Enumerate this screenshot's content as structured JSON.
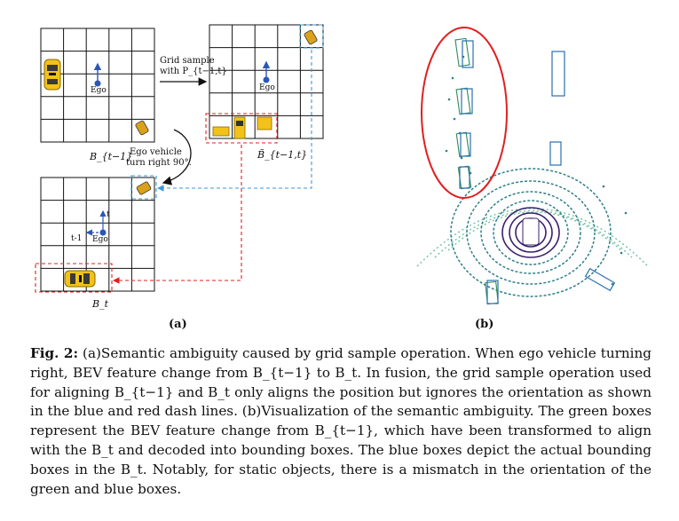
{
  "figure": {
    "panel_a": {
      "grid_top_label": "B_{t−1}",
      "grid_right_label": "B̃_{t−1,t}",
      "grid_bottom_label": "B_t",
      "ego_label": "Ego",
      "arrow_t": "t",
      "arrow_t1": "t-1",
      "grid_sample_line1": "Grid sample",
      "grid_sample_line2": "with P_{t−1,t}",
      "ego_turn_line1": "Ego vehicle",
      "ego_turn_line2": "turn right 90°.",
      "subfig_label": "(a)"
    },
    "panel_b": {
      "subfig_label": "(b)"
    },
    "colors": {
      "grid": "#000000",
      "ego_dot": "#2b56b8",
      "red_dash": "#e02020",
      "blue_dash": "#3a9ad9",
      "ellipse": "#e02020",
      "green_box": "#2e8b57",
      "blue_box": "#2b6fb0",
      "lidar_dark": "#3b1f6b",
      "lidar_mid": "#2f7f8a",
      "lidar_light": "#6fc2a0",
      "taxi_yellow": "#f2c21b"
    }
  },
  "caption": {
    "label": "Fig. 2:",
    "text": "(a)Semantic ambiguity caused by grid sample operation. When ego vehicle turning right, BEV feature change from B_{t−1} to B_t. In fusion, the grid sample operation used for aligning B_{t−1} and B_t only aligns the position but ignores the orientation as shown in the blue and red dash lines. (b)Visualization of the semantic ambiguity. The green boxes represent the BEV feature change from B_{t−1}, which have been transformed to align with the B_t and decoded into bounding boxes. The blue boxes depict the actual bounding boxes in the B_t. Notably, for static objects, there is a mismatch in the orientation of the green and blue boxes."
  }
}
